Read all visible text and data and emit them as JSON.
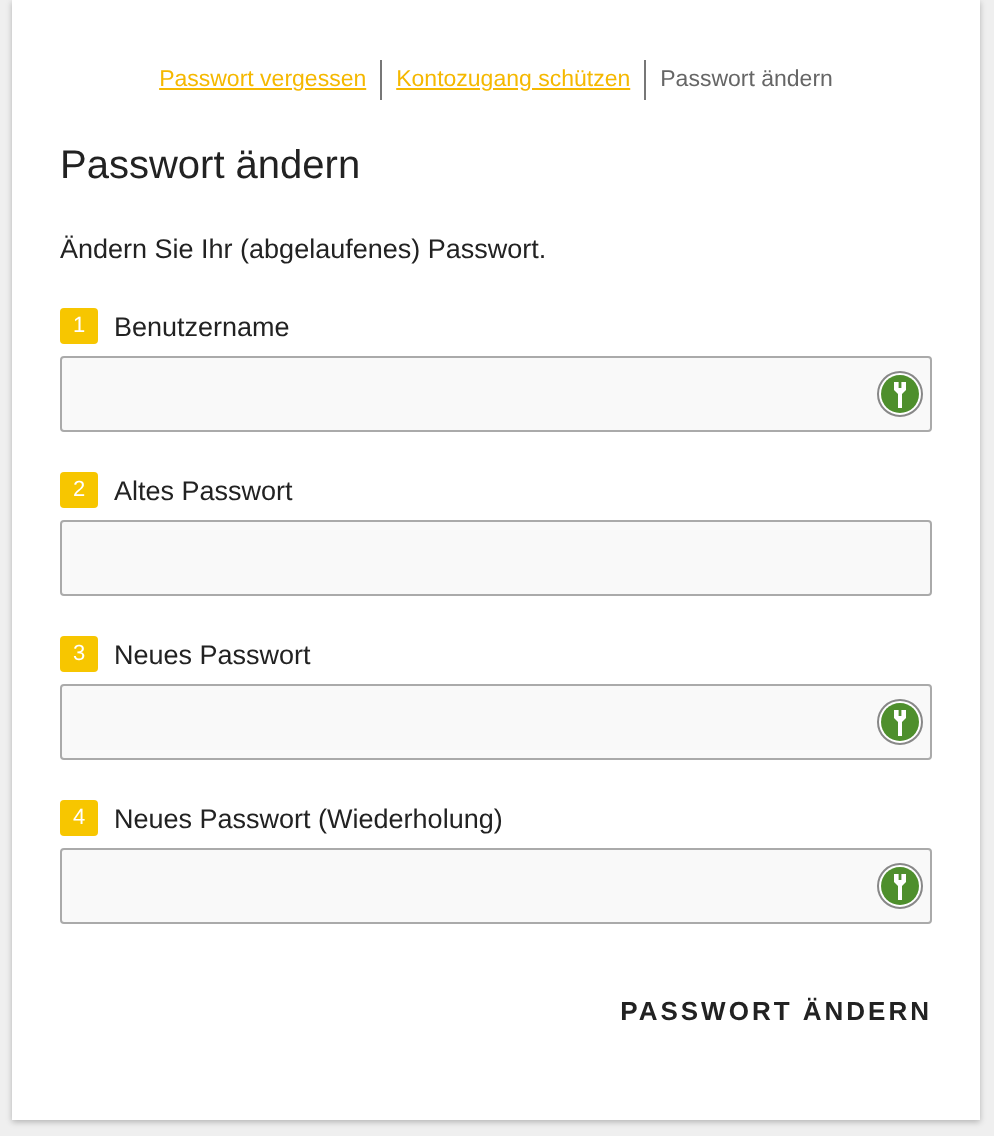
{
  "breadcrumbs": [
    {
      "label": "Passwort vergessen",
      "selected": false
    },
    {
      "label": "Kontozugang schützen",
      "selected": false
    },
    {
      "label": "Passwort ändern",
      "selected": true
    }
  ],
  "title": "Passwort ändern",
  "description": "Ändern Sie Ihr (abgelaufenes) Passwort.",
  "fields": [
    {
      "number": "1",
      "label": "Benutzername",
      "key_icon": true
    },
    {
      "number": "2",
      "label": "Altes Passwort",
      "key_icon": false
    },
    {
      "number": "3",
      "label": "Neues Passwort",
      "key_icon": true
    },
    {
      "number": "4",
      "label": "Neues Passwort (Wiederholung)",
      "key_icon": true
    }
  ],
  "submit": "PASSWORT ÄNDERN"
}
